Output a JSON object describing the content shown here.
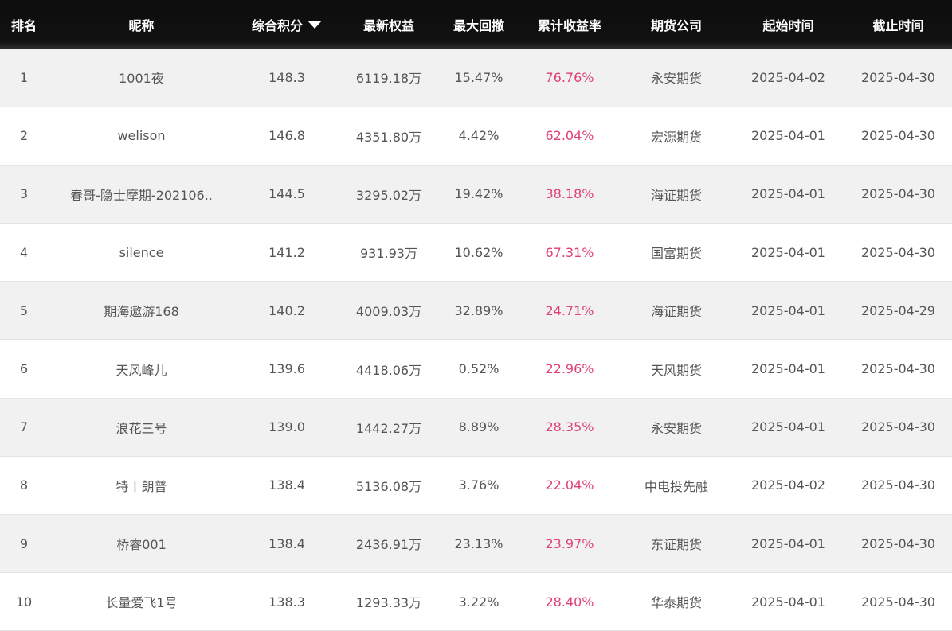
{
  "columns": [
    "排名",
    "昵称",
    "综合积分",
    "最新权益",
    "最大回撤",
    "累计收益率",
    "期货公司",
    "起始时间",
    "截止时间"
  ],
  "sort_indicator": "triangle-down-icon",
  "colors": {
    "header_bg": "#111111",
    "header_text": "#ffffff",
    "return_color": "#e0407a",
    "row_alt_bg": "#f1f1f1"
  },
  "rows": [
    {
      "rank": "1",
      "nick": "1001夜",
      "score": "148.3",
      "equity": "6119.18万",
      "drawdown": "15.47%",
      "return": "76.76%",
      "company": "永安期货",
      "start": "2025-04-02",
      "end": "2025-04-30"
    },
    {
      "rank": "2",
      "nick": "welison",
      "score": "146.8",
      "equity": "4351.80万",
      "drawdown": "4.42%",
      "return": "62.04%",
      "company": "宏源期货",
      "start": "2025-04-01",
      "end": "2025-04-30"
    },
    {
      "rank": "3",
      "nick": "春哥-隐士摩期-202106..",
      "score": "144.5",
      "equity": "3295.02万",
      "drawdown": "19.42%",
      "return": "38.18%",
      "company": "海证期货",
      "start": "2025-04-01",
      "end": "2025-04-30"
    },
    {
      "rank": "4",
      "nick": "silence",
      "score": "141.2",
      "equity": "931.93万",
      "drawdown": "10.62%",
      "return": "67.31%",
      "company": "国富期货",
      "start": "2025-04-01",
      "end": "2025-04-30"
    },
    {
      "rank": "5",
      "nick": "期海遨游168",
      "score": "140.2",
      "equity": "4009.03万",
      "drawdown": "32.89%",
      "return": "24.71%",
      "company": "海证期货",
      "start": "2025-04-01",
      "end": "2025-04-29"
    },
    {
      "rank": "6",
      "nick": "天风峰儿",
      "score": "139.6",
      "equity": "4418.06万",
      "drawdown": "0.52%",
      "return": "22.96%",
      "company": "天风期货",
      "start": "2025-04-01",
      "end": "2025-04-30"
    },
    {
      "rank": "7",
      "nick": "浪花三号",
      "score": "139.0",
      "equity": "1442.27万",
      "drawdown": "8.89%",
      "return": "28.35%",
      "company": "永安期货",
      "start": "2025-04-01",
      "end": "2025-04-30"
    },
    {
      "rank": "8",
      "nick": "特丨朗普",
      "score": "138.4",
      "equity": "5136.08万",
      "drawdown": "3.76%",
      "return": "22.04%",
      "company": "中电投先融",
      "start": "2025-04-02",
      "end": "2025-04-30"
    },
    {
      "rank": "9",
      "nick": "桥睿001",
      "score": "138.4",
      "equity": "2436.91万",
      "drawdown": "23.13%",
      "return": "23.97%",
      "company": "东证期货",
      "start": "2025-04-01",
      "end": "2025-04-30"
    },
    {
      "rank": "10",
      "nick": "长量爱飞1号",
      "score": "138.3",
      "equity": "1293.33万",
      "drawdown": "3.22%",
      "return": "28.40%",
      "company": "华泰期货",
      "start": "2025-04-01",
      "end": "2025-04-30"
    }
  ]
}
